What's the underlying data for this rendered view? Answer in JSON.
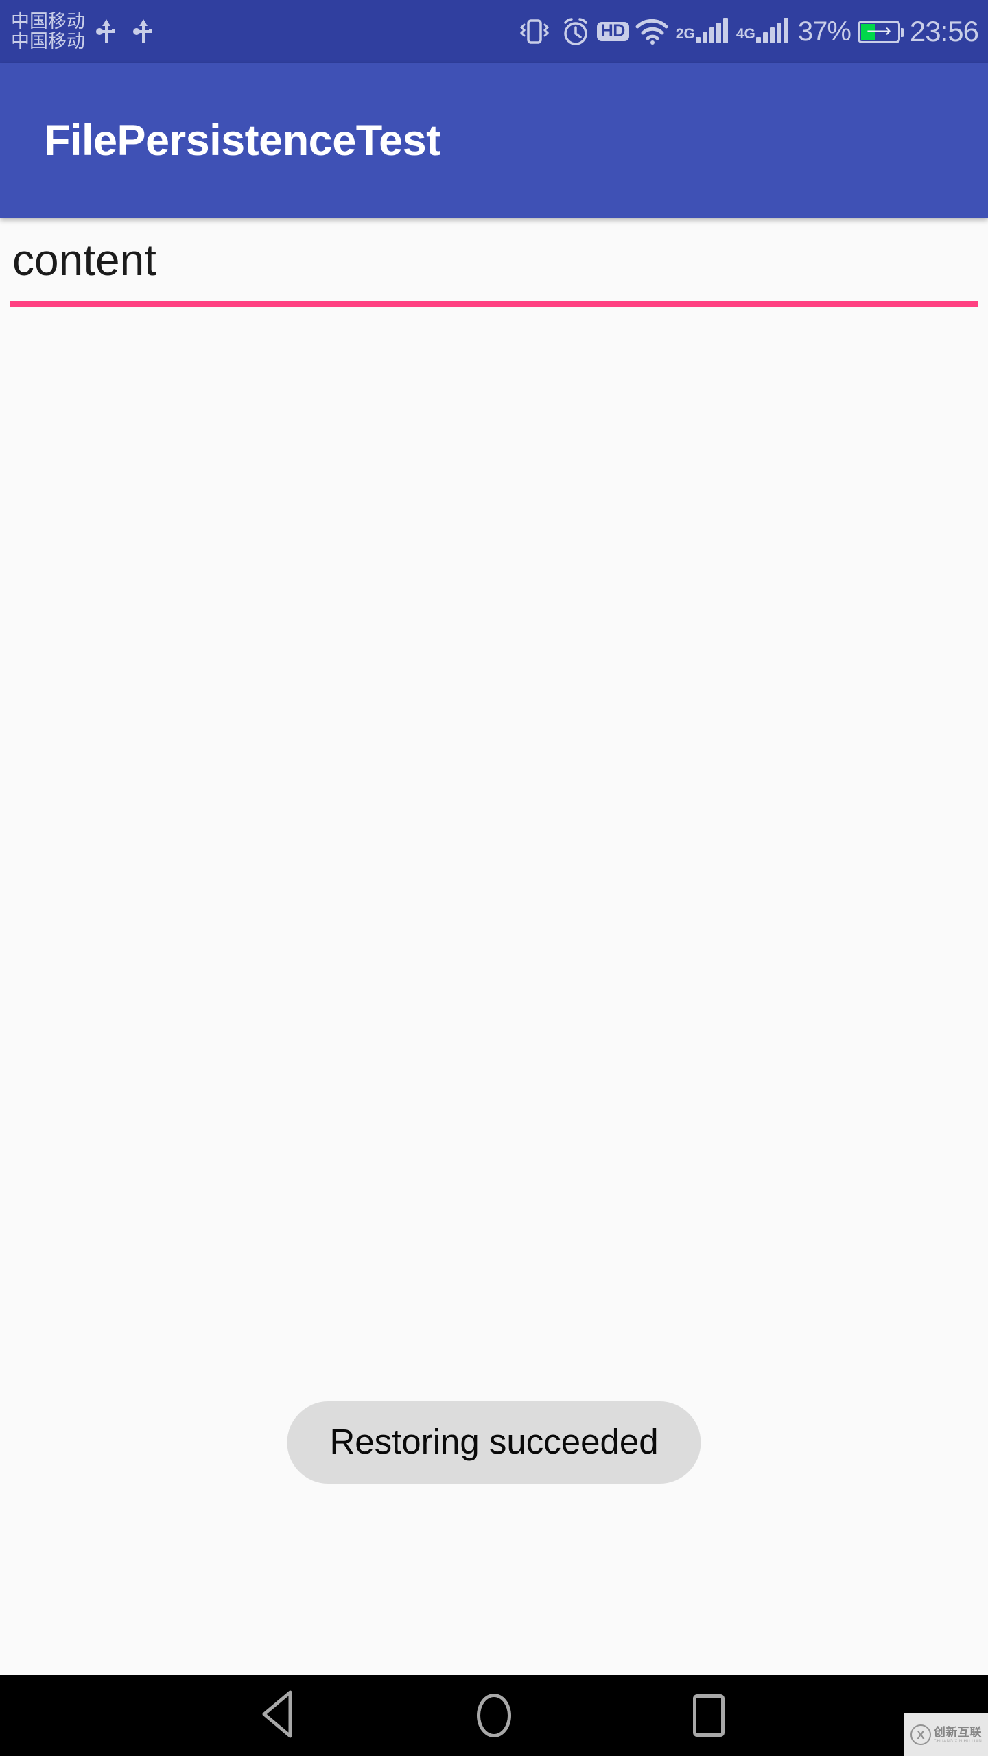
{
  "status_bar": {
    "carrier_lines": [
      "中国移动",
      "中国移动"
    ],
    "usb_icons": [
      "usb-icon",
      "usb-icon"
    ],
    "vibrate_icon": "vibrate-icon",
    "alarm_icon": "alarm-clock-icon",
    "hd_badge": "HD",
    "wifi_icon": "wifi-icon",
    "sim1_network": "2G",
    "sim2_network": "4G",
    "battery_percent": "37%",
    "battery_charging": true,
    "battery_level": 37,
    "clock": "23:56",
    "background_color": "#303F9F",
    "foreground_color": "#C9CEE8"
  },
  "app_bar": {
    "title": "FilePersistenceTest",
    "background_color": "#3F51B5",
    "title_color": "#FFFFFF"
  },
  "main": {
    "edit_text": {
      "value": "content",
      "placeholder": "",
      "underline_color": "#FF4081",
      "text_color": "#1B1B1B"
    },
    "background_color": "#FAFAFA"
  },
  "toast": {
    "message": "Restoring succeeded",
    "background_color": "#DCDCDC",
    "text_color": "#0A0A0A"
  },
  "nav_bar": {
    "background_color": "#000000",
    "icon_color": "#A8A8A8",
    "buttons": [
      {
        "name": "back",
        "icon": "triangle-left-icon"
      },
      {
        "name": "home",
        "icon": "circle-icon"
      },
      {
        "name": "recents",
        "icon": "square-icon"
      }
    ]
  },
  "watermark": {
    "logo": "circled-x-icon",
    "logo_char": "X",
    "chinese": "创新互联",
    "pinyin": "CHUANG XIN HU LIAN"
  }
}
